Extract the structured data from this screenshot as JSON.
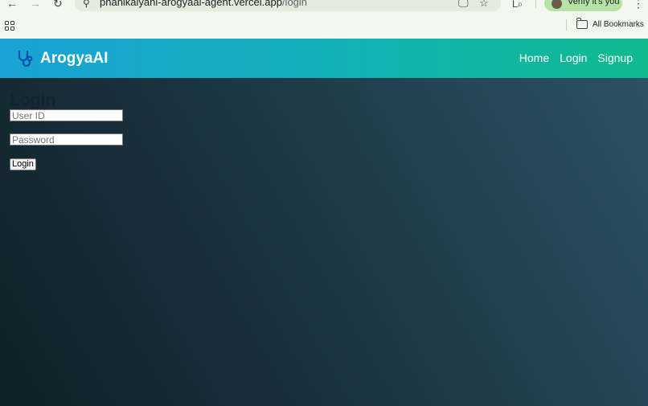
{
  "browser": {
    "url_host": "phanikalyani-arogyaai-agent.vercel.app",
    "url_path": "/login",
    "profile_label": "Verify it's you",
    "bookmarks_label": "All Bookmarks"
  },
  "header": {
    "brand": "ArogyaAI",
    "nav": [
      "Home",
      "Login",
      "Signup"
    ]
  },
  "login": {
    "title": "Login",
    "user_id_placeholder": "User ID",
    "password_placeholder": "Password",
    "submit_label": "Login"
  },
  "colors": {
    "header_start": "#19a3d6",
    "header_end": "#10b98e",
    "background_dark": "#0f1f26",
    "background_light": "#2c5264"
  }
}
